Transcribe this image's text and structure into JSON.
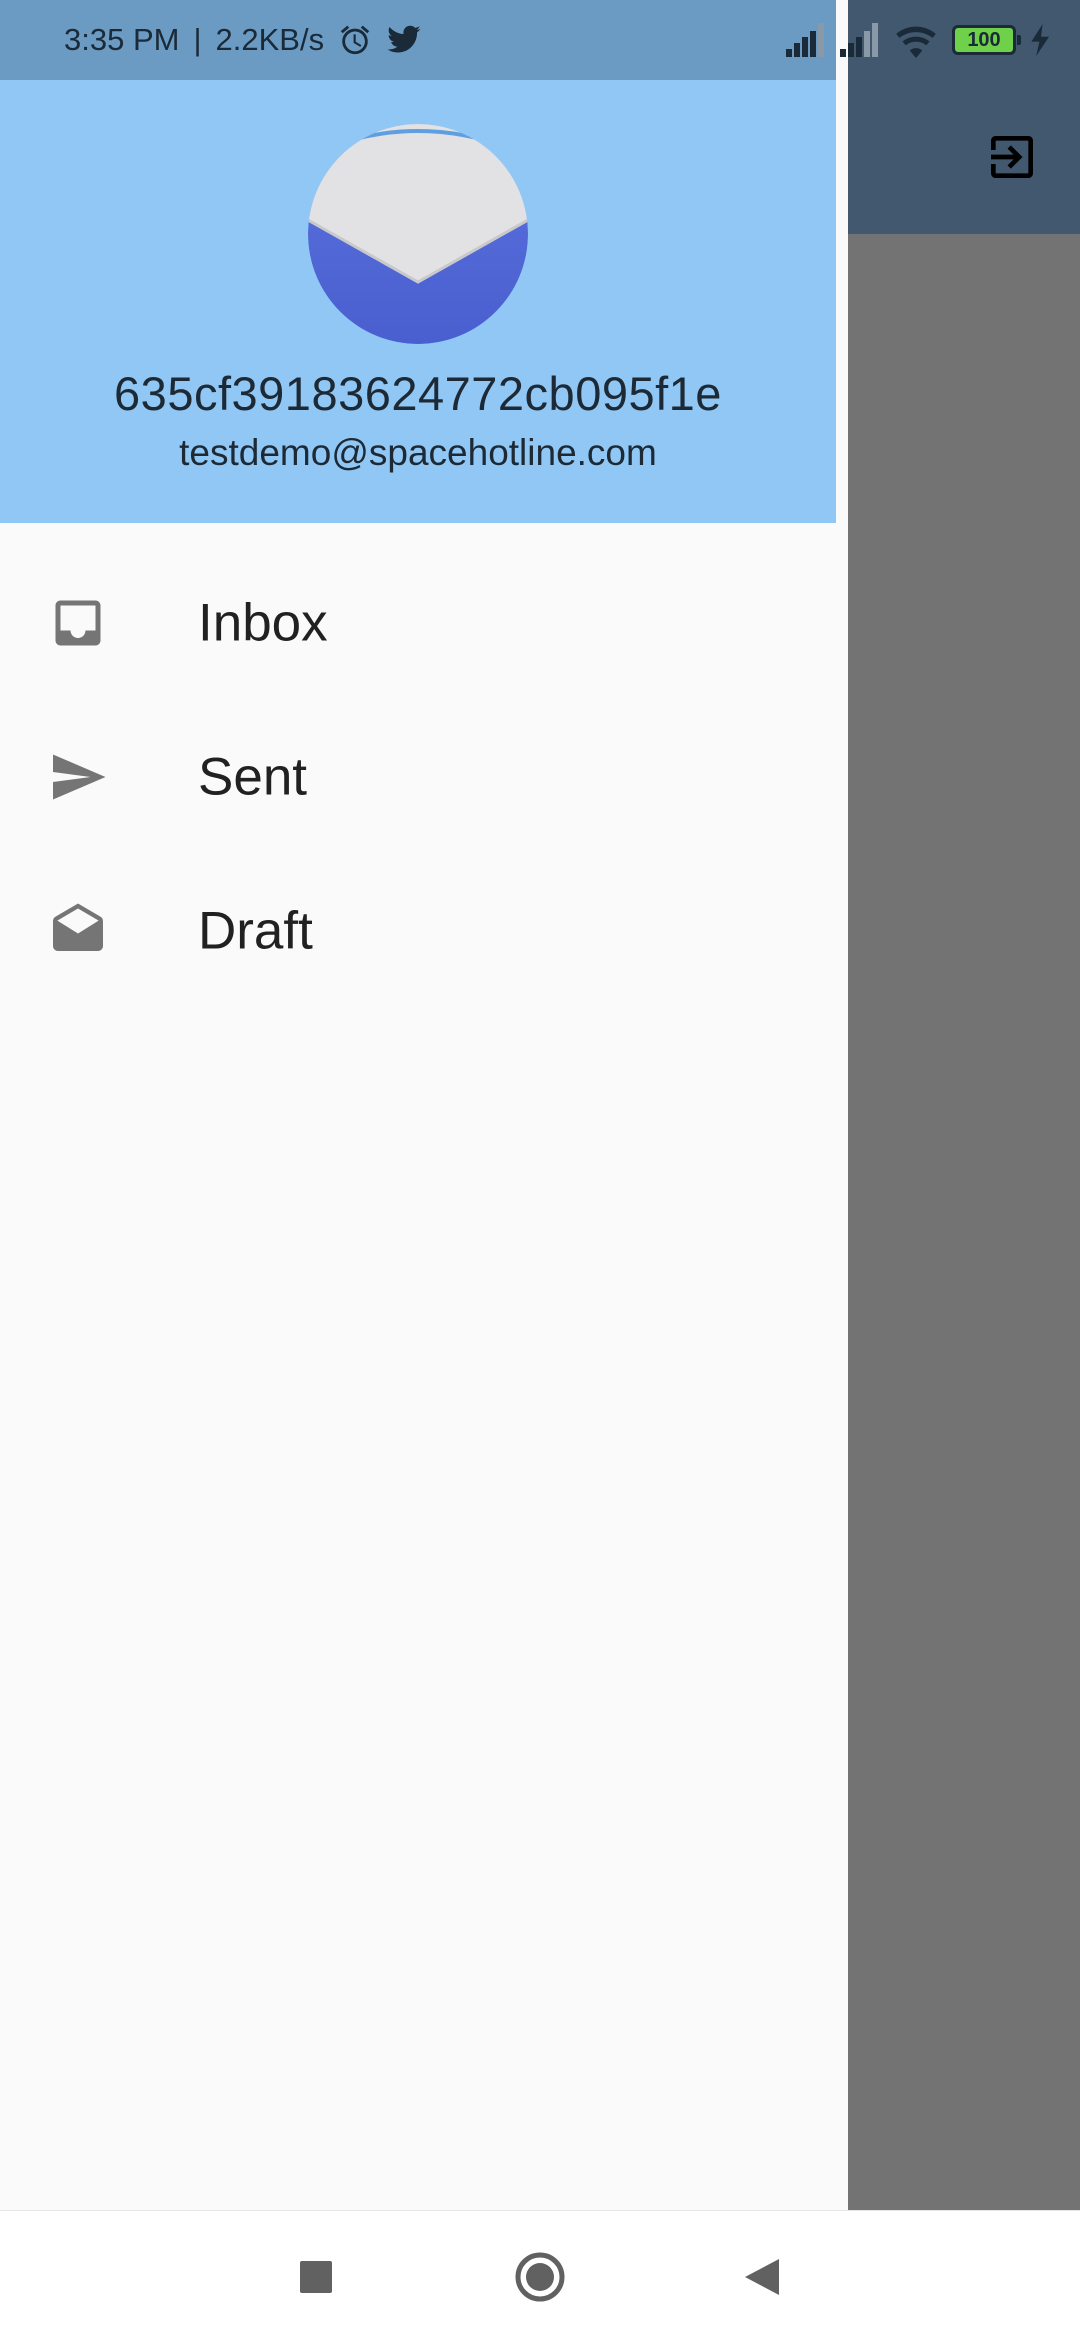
{
  "status_bar": {
    "time": "3:35 PM",
    "separator": "|",
    "network_speed": "2.2KB/s",
    "battery_level": "100",
    "icons": [
      "alarm-icon",
      "twitter-icon",
      "signal-icon",
      "signal-icon",
      "wifi-icon",
      "battery-icon",
      "charging-icon"
    ]
  },
  "drawer": {
    "header": {
      "user_id": "635cf39183624772cb095f1e",
      "email": "testdemo@spacehotline.com"
    },
    "items": [
      {
        "label": "Inbox",
        "icon": "inbox-icon"
      },
      {
        "label": "Sent",
        "icon": "send-icon"
      },
      {
        "label": "Draft",
        "icon": "drafts-icon"
      }
    ]
  },
  "app_bar": {
    "action_icon": "logout-icon"
  },
  "nav_bar": {
    "icons": [
      "recents-icon",
      "home-icon",
      "back-icon"
    ]
  },
  "colors": {
    "header_bg": "#90C7F5",
    "drawer_bg": "#FAFAFA",
    "scrim": "#737373",
    "app_bar_dimmed": "#41586E",
    "icon_grey": "#757575"
  }
}
